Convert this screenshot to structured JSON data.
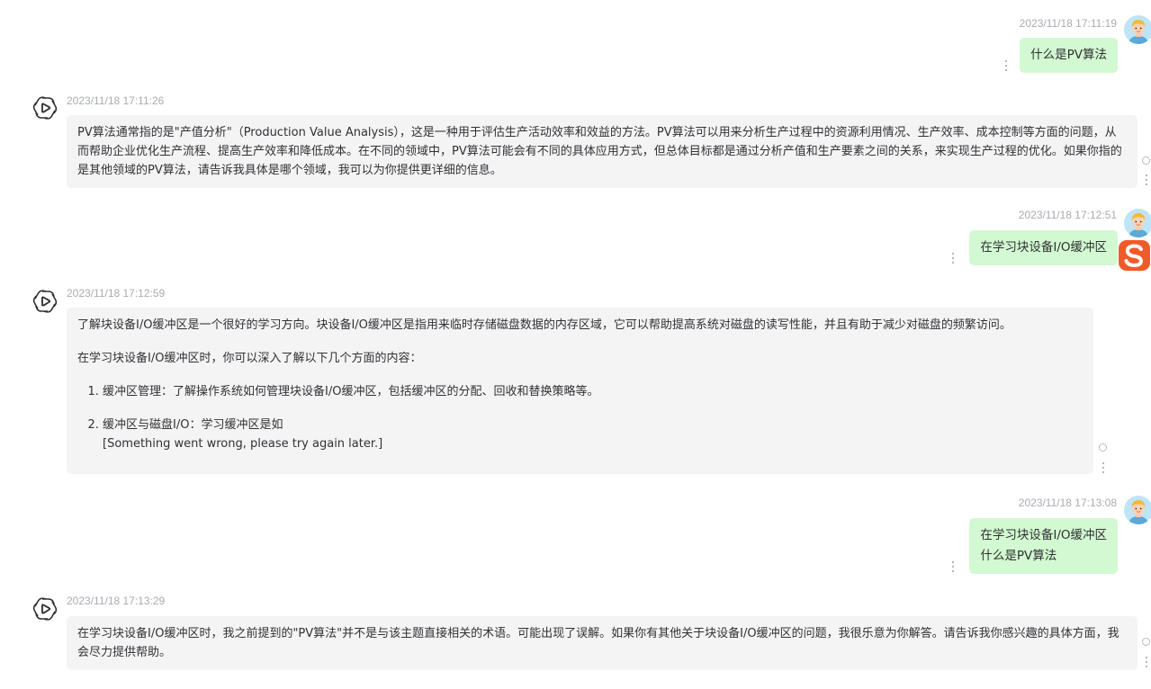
{
  "conversation": [
    {
      "role": "user",
      "time": "2023/11/18 17:11:19",
      "lines": [
        "什么是PV算法"
      ]
    },
    {
      "role": "assistant",
      "time": "2023/11/18 17:11:26",
      "text": "PV算法通常指的是\"产值分析\"（Production Value Analysis），这是一种用于评估生产活动效率和效益的方法。PV算法可以用来分析生产过程中的资源利用情况、生产效率、成本控制等方面的问题，从而帮助企业优化生产流程、提高生产效率和降低成本。在不同的领域中，PV算法可能会有不同的具体应用方式，但总体目标都是通过分析产值和生产要素之间的关系，来实现生产过程的优化。如果你指的是其他领域的PV算法，请告诉我具体是哪个领域，我可以为你提供更详细的信息。"
    },
    {
      "role": "user",
      "time": "2023/11/18 17:12:51",
      "lines": [
        "在学习块设备I/O缓冲区"
      ]
    },
    {
      "role": "assistant",
      "time": "2023/11/18 17:12:59",
      "intro": "了解块设备I/O缓冲区是一个很好的学习方向。块设备I/O缓冲区是指用来临时存储磁盘数据的内存区域，它可以帮助提高系统对磁盘的读写性能，并且有助于减少对磁盘的频繁访问。",
      "lead": "在学习块设备I/O缓冲区时，你可以深入了解以下几个方面的内容：",
      "items": [
        "缓冲区管理：了解操作系统如何管理块设备I/O缓冲区，包括缓冲区的分配、回收和替换策略等。",
        "缓冲区与磁盘I/O：学习缓冲区是如"
      ],
      "error": "[Something went wrong, please try again later.]"
    },
    {
      "role": "user",
      "time": "2023/11/18 17:13:08",
      "lines": [
        "在学习块设备I/O缓冲区",
        "什么是PV算法"
      ]
    },
    {
      "role": "assistant",
      "time": "2023/11/18 17:13:29",
      "text": "在学习块设备I/O缓冲区时，我之前提到的\"PV算法\"并不是与该主题直接相关的术语。可能出现了误解。如果你有其他关于块设备I/O缓冲区的问题，我很乐意为你解答。请告诉我你感兴趣的具体方面，我会尽力提供帮助。"
    }
  ],
  "icons": {
    "user_avatar": "cartoon-user-avatar-icon",
    "bot_avatar": "openai-logo-icon",
    "menu": "more-vertical-icon",
    "status": "circle-status-icon",
    "ime": "sogou-ime-icon"
  },
  "colors": {
    "user_bubble": "#d2f9d1",
    "bot_bubble": "#f4f4f5",
    "timestamp": "#a8abb2",
    "ime": "#f05a28"
  }
}
